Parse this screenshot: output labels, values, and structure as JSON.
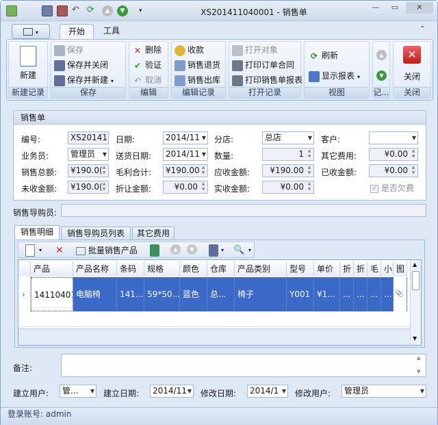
{
  "window": {
    "title": "XS201411040001 - 销售单",
    "controls": {
      "min": "—",
      "restore": "▭",
      "close": "✕"
    }
  },
  "ribbon": {
    "app_menu_icon": "app-menu-icon",
    "tabs": [
      {
        "label": "开始"
      },
      {
        "label": "工具"
      }
    ],
    "groups": {
      "new_record": {
        "label": "新建记录",
        "new": "新建"
      },
      "save": {
        "label": "保存",
        "save": "保存",
        "save_close": "保存并关闭",
        "save_new": "保存并新建"
      },
      "edit": {
        "label": "编辑",
        "delete": "删除",
        "verify": "验证",
        "cancel": "取消"
      },
      "edit_record": {
        "label": "编辑记录",
        "receive": "收款",
        "sales_return": "销售退货",
        "sales_out": "销售出库"
      },
      "open_record": {
        "label": "打开记录",
        "open_object": "打开对象",
        "print_contract": "打印订单合同",
        "print_report": "打印销售单报表"
      },
      "view": {
        "label": "视图",
        "refresh": "刷新",
        "show_report": "显示报表"
      },
      "record_nav": {
        "label": "记..."
      },
      "close": {
        "label": "关闭",
        "close": "关闭"
      }
    }
  },
  "form": {
    "title": "销售单",
    "fields": {
      "number": {
        "label": "编号:",
        "value": "XS201411"
      },
      "date": {
        "label": "日期:",
        "value": "2014/11"
      },
      "branch": {
        "label": "分店:",
        "value": "总店"
      },
      "customer": {
        "label": "客户:",
        "value": ""
      },
      "salesman": {
        "label": "业务员:",
        "value": "管理员"
      },
      "delivery_date": {
        "label": "送货日期:",
        "value": "2014/11"
      },
      "quantity": {
        "label": "数量:",
        "value": "1"
      },
      "other_fee": {
        "label": "其它费用:",
        "value": "¥0.00"
      },
      "sales_total": {
        "label": "销售总额:",
        "value": "¥190.0("
      },
      "gross_profit": {
        "label": "毛利合计:",
        "value": "¥190.00"
      },
      "receivable": {
        "label": "应收金额:",
        "value": "¥190.00"
      },
      "received": {
        "label": "已收金额:",
        "value": "¥0.00"
      },
      "unreceived": {
        "label": "未收金额:",
        "value": "¥190.0("
      },
      "discount": {
        "label": "折让金额:",
        "value": "¥0.00"
      },
      "actual_received": {
        "label": "实收金额:",
        "value": "¥0.00"
      },
      "is_owed": {
        "label": "是否欠费",
        "checked": true
      }
    },
    "guide_label": "销售导购员:",
    "guide_value": ""
  },
  "detail": {
    "tabs": [
      {
        "label": "销售明细"
      },
      {
        "label": "销售导购员列表"
      },
      {
        "label": "其它费用"
      }
    ],
    "toolbar": {
      "batch_sell": "批量销售产品"
    },
    "columns": [
      "产品",
      "产品名称",
      "条码",
      "规格",
      "颜色",
      "仓库",
      "产品类别",
      "型号",
      "单价",
      "折",
      "折",
      "毛",
      "小",
      "图"
    ],
    "rows": [
      {
        "indicator": "›",
        "cells": [
          "14110401",
          "电脑椅",
          "141...",
          "59*50...",
          "蓝色",
          "总...",
          "椅子",
          "Y001",
          "¥1...",
          "...",
          "...",
          "...",
          "...",
          "📎"
        ]
      }
    ]
  },
  "bottom": {
    "remark_label": "备注:",
    "remark_value": "",
    "creator_label": "建立用户:",
    "creator_value": "管...",
    "created_date_label": "建立日期:",
    "created_date_value": "2014/11",
    "modified_date_label": "修改日期:",
    "modified_date_value": "2014/1",
    "modifier_label": "修改用户:",
    "modifier_value": "管理员"
  },
  "status": {
    "text": "登录账号: admin"
  }
}
